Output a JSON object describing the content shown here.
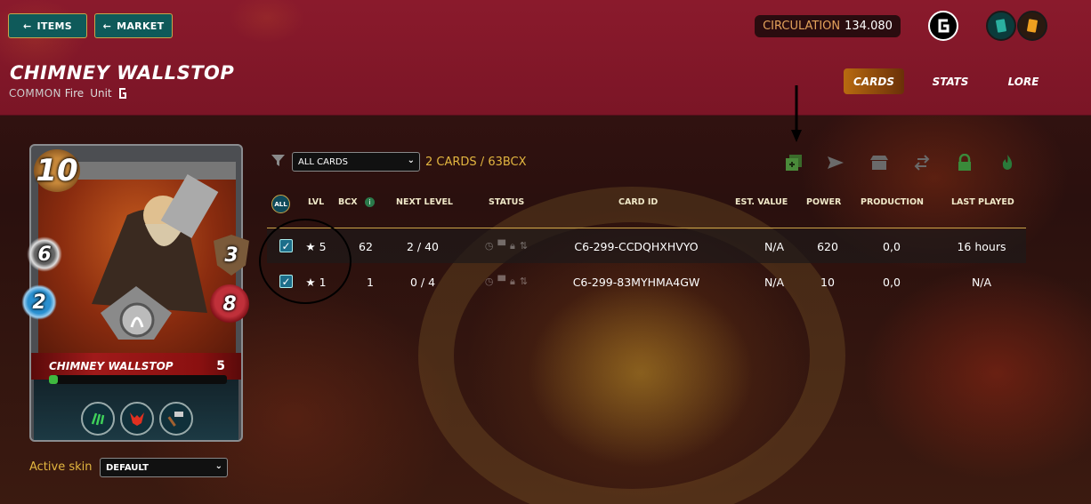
{
  "header": {
    "items_button": "ITEMS",
    "market_button": "MARKET",
    "circulation_label": "CIRCULATION",
    "circulation_value": "134.080"
  },
  "card_info": {
    "name": "CHIMNEY WALLSTOP",
    "rarity": "COMMON",
    "element": "Fire",
    "type": "Unit"
  },
  "tabs": [
    {
      "label": "CARDS",
      "active": true
    },
    {
      "label": "STATS",
      "active": false
    },
    {
      "label": "LORE",
      "active": false
    }
  ],
  "card": {
    "mana": "10",
    "melee": "6",
    "speed": "2",
    "armor": "3",
    "health": "8",
    "banner_name": "CHIMNEY WALLSTOP",
    "banner_level": "5",
    "xp_fraction": 0.05,
    "abilities": [
      "claw-ability-icon",
      "demon-ability-icon",
      "hammer-ability-icon"
    ]
  },
  "skin": {
    "label": "Active skin",
    "value": "DEFAULT"
  },
  "filter": {
    "select_value": "ALL CARDS",
    "count_text": "2 CARDS / 63BCX"
  },
  "table": {
    "all_label": "ALL",
    "headers": [
      "LVL",
      "BCX",
      "NEXT LEVEL",
      "STATUS",
      "CARD ID",
      "EST. VALUE",
      "POWER",
      "PRODUCTION",
      "LAST PLAYED"
    ],
    "rows": [
      {
        "lvl": "★ 5",
        "bcx": "62",
        "next_level": "2 / 40",
        "card_id": "C6-299-CCDQHXHVYO",
        "est_value": "N/A",
        "power": "620",
        "production": "0,0",
        "last_played": "16 hours"
      },
      {
        "lvl": "★ 1",
        "bcx": "1",
        "next_level": "0 / 4",
        "card_id": "C6-299-83MYHMA4GW",
        "est_value": "N/A",
        "power": "10",
        "production": "0,0",
        "last_played": "N/A"
      }
    ]
  },
  "colors": {
    "banner": "#8a1a2c",
    "gold": "#e3b640",
    "teal_button": "#0f5a5a"
  }
}
